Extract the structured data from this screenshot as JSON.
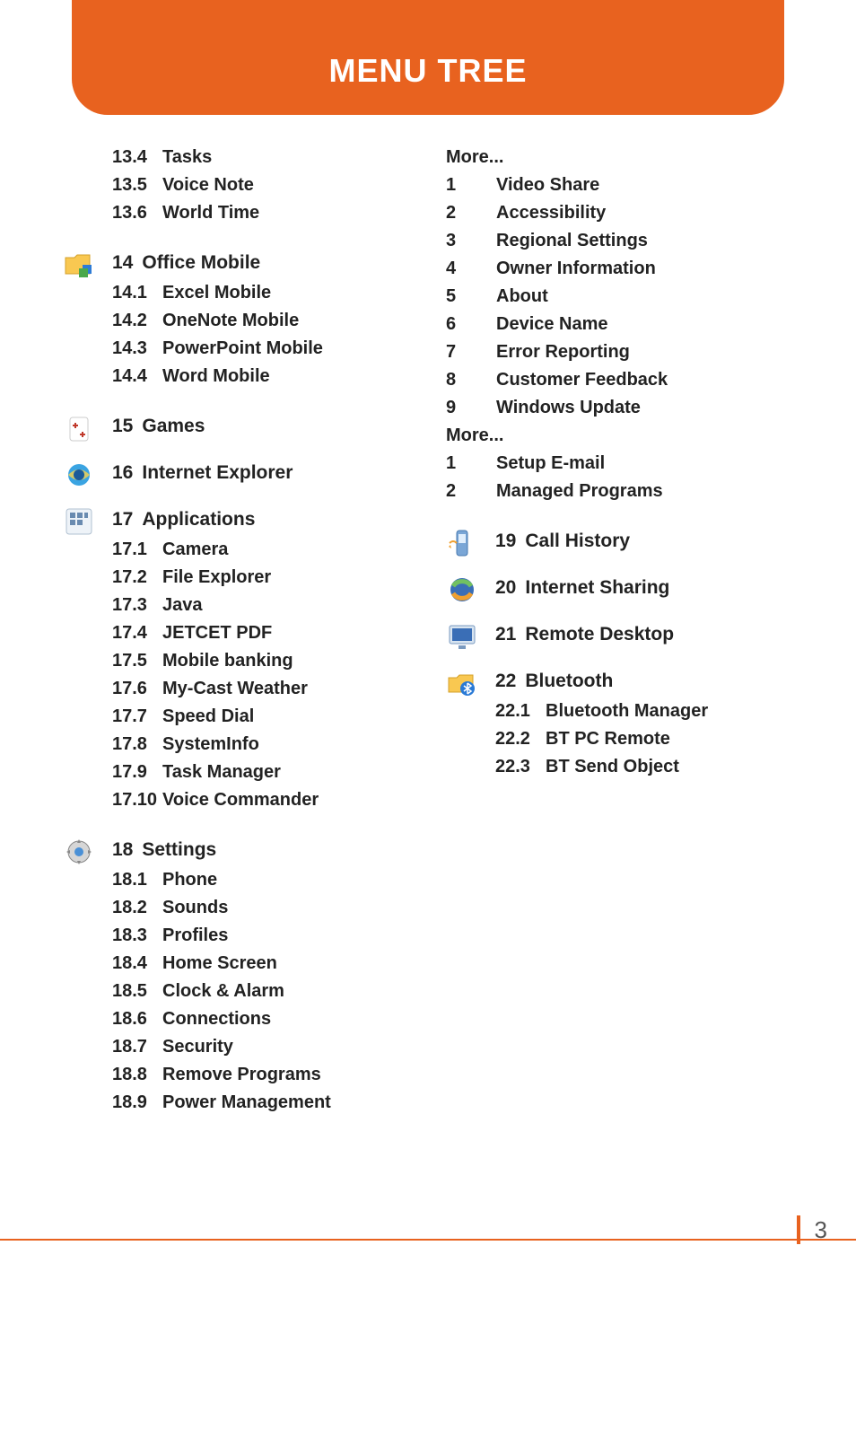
{
  "header": {
    "title": "MENU TREE"
  },
  "page_number": "3",
  "left": {
    "pre_items": [
      {
        "num": "13.4",
        "label": "Tasks"
      },
      {
        "num": "13.5",
        "label": "Voice Note"
      },
      {
        "num": "13.6",
        "label": "World Time"
      }
    ],
    "s14": {
      "num": "14",
      "title": "Office Mobile",
      "items": [
        {
          "num": "14.1",
          "label": "Excel Mobile"
        },
        {
          "num": "14.2",
          "label": "OneNote Mobile"
        },
        {
          "num": "14.3",
          "label": "PowerPoint Mobile"
        },
        {
          "num": "14.4",
          "label": "Word Mobile"
        }
      ]
    },
    "s15": {
      "num": "15",
      "title": "Games"
    },
    "s16": {
      "num": "16",
      "title": "Internet Explorer"
    },
    "s17": {
      "num": "17",
      "title": "Applications",
      "items": [
        {
          "num": "17.1",
          "label": "Camera"
        },
        {
          "num": "17.2",
          "label": "File Explorer"
        },
        {
          "num": "17.3",
          "label": "Java"
        },
        {
          "num": "17.4",
          "label": "JETCET PDF"
        },
        {
          "num": "17.5",
          "label": "Mobile banking"
        },
        {
          "num": "17.6",
          "label": "My-Cast Weather"
        },
        {
          "num": "17.7",
          "label": "Speed Dial"
        },
        {
          "num": "17.8",
          "label": "SystemInfo"
        },
        {
          "num": "17.9",
          "label": "Task Manager"
        },
        {
          "num": "17.10",
          "label": "Voice Commander"
        }
      ]
    },
    "s18": {
      "num": "18",
      "title": "Settings",
      "items": [
        {
          "num": "18.1",
          "label": "Phone"
        },
        {
          "num": "18.2",
          "label": "Sounds"
        },
        {
          "num": "18.3",
          "label": "Profiles"
        },
        {
          "num": "18.4",
          "label": "Home Screen"
        },
        {
          "num": "18.5",
          "label": "Clock & Alarm"
        },
        {
          "num": "18.6",
          "label": "Connections"
        },
        {
          "num": "18.7",
          "label": "Security"
        },
        {
          "num": "18.8",
          "label": "Remove Programs"
        },
        {
          "num": "18.9",
          "label": "Power Management"
        }
      ]
    }
  },
  "right": {
    "more1_label": "More...",
    "more1": [
      {
        "num": "1",
        "label": "Video Share"
      },
      {
        "num": "2",
        "label": "Accessibility"
      },
      {
        "num": "3",
        "label": "Regional Settings"
      },
      {
        "num": "4",
        "label": "Owner Information"
      },
      {
        "num": "5",
        "label": "About"
      },
      {
        "num": "6",
        "label": "Device Name"
      },
      {
        "num": "7",
        "label": "Error Reporting"
      },
      {
        "num": "8",
        "label": "Customer Feedback"
      },
      {
        "num": "9",
        "label": "Windows Update"
      }
    ],
    "more2_label": "More...",
    "more2": [
      {
        "num": "1",
        "label": "Setup E-mail"
      },
      {
        "num": "2",
        "label": "Managed Programs"
      }
    ],
    "s19": {
      "num": "19",
      "title": "Call History"
    },
    "s20": {
      "num": "20",
      "title": "Internet Sharing"
    },
    "s21": {
      "num": "21",
      "title": "Remote Desktop"
    },
    "s22": {
      "num": "22",
      "title": "Bluetooth",
      "items": [
        {
          "num": "22.1",
          "label": "Bluetooth Manager"
        },
        {
          "num": "22.2",
          "label": "BT PC Remote"
        },
        {
          "num": "22.3",
          "label": "BT Send Object"
        }
      ]
    }
  }
}
